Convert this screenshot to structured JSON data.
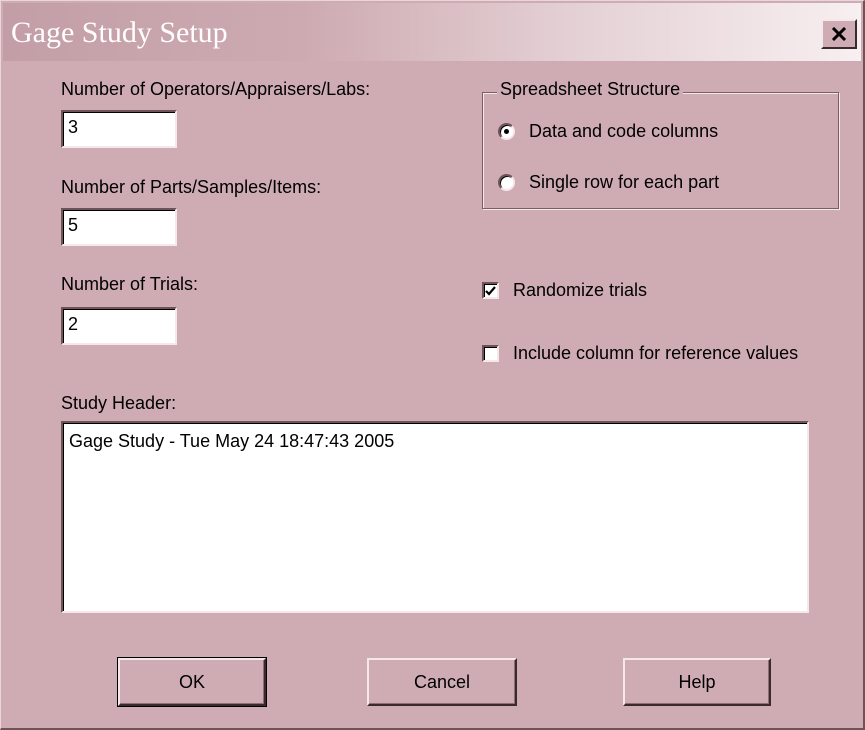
{
  "window": {
    "title": "Gage Study Setup",
    "close_label": "×"
  },
  "fields": {
    "operators_label": "Number of Operators/Appraisers/Labs:",
    "operators_value": "3",
    "parts_label": "Number of Parts/Samples/Items:",
    "parts_value": "5",
    "trials_label": "Number of Trials:",
    "trials_value": "2"
  },
  "structure": {
    "title": "Spreadsheet Structure",
    "options": [
      {
        "label": "Data and code columns",
        "selected": true
      },
      {
        "label": "Single row for each part",
        "selected": false
      }
    ]
  },
  "options": {
    "randomize_label": "Randomize trials",
    "randomize_checked": true,
    "reference_label": "Include column for reference values",
    "reference_checked": false
  },
  "header": {
    "label": "Study Header:",
    "value": "Gage Study - Tue May 24 18:47:43 2005"
  },
  "buttons": {
    "ok": "OK",
    "cancel": "Cancel",
    "help": "Help"
  },
  "colors": {
    "dialog_background": "#cfacb3",
    "title_gradient_start": "#c39ea6",
    "title_gradient_end": "#f7eff1"
  }
}
